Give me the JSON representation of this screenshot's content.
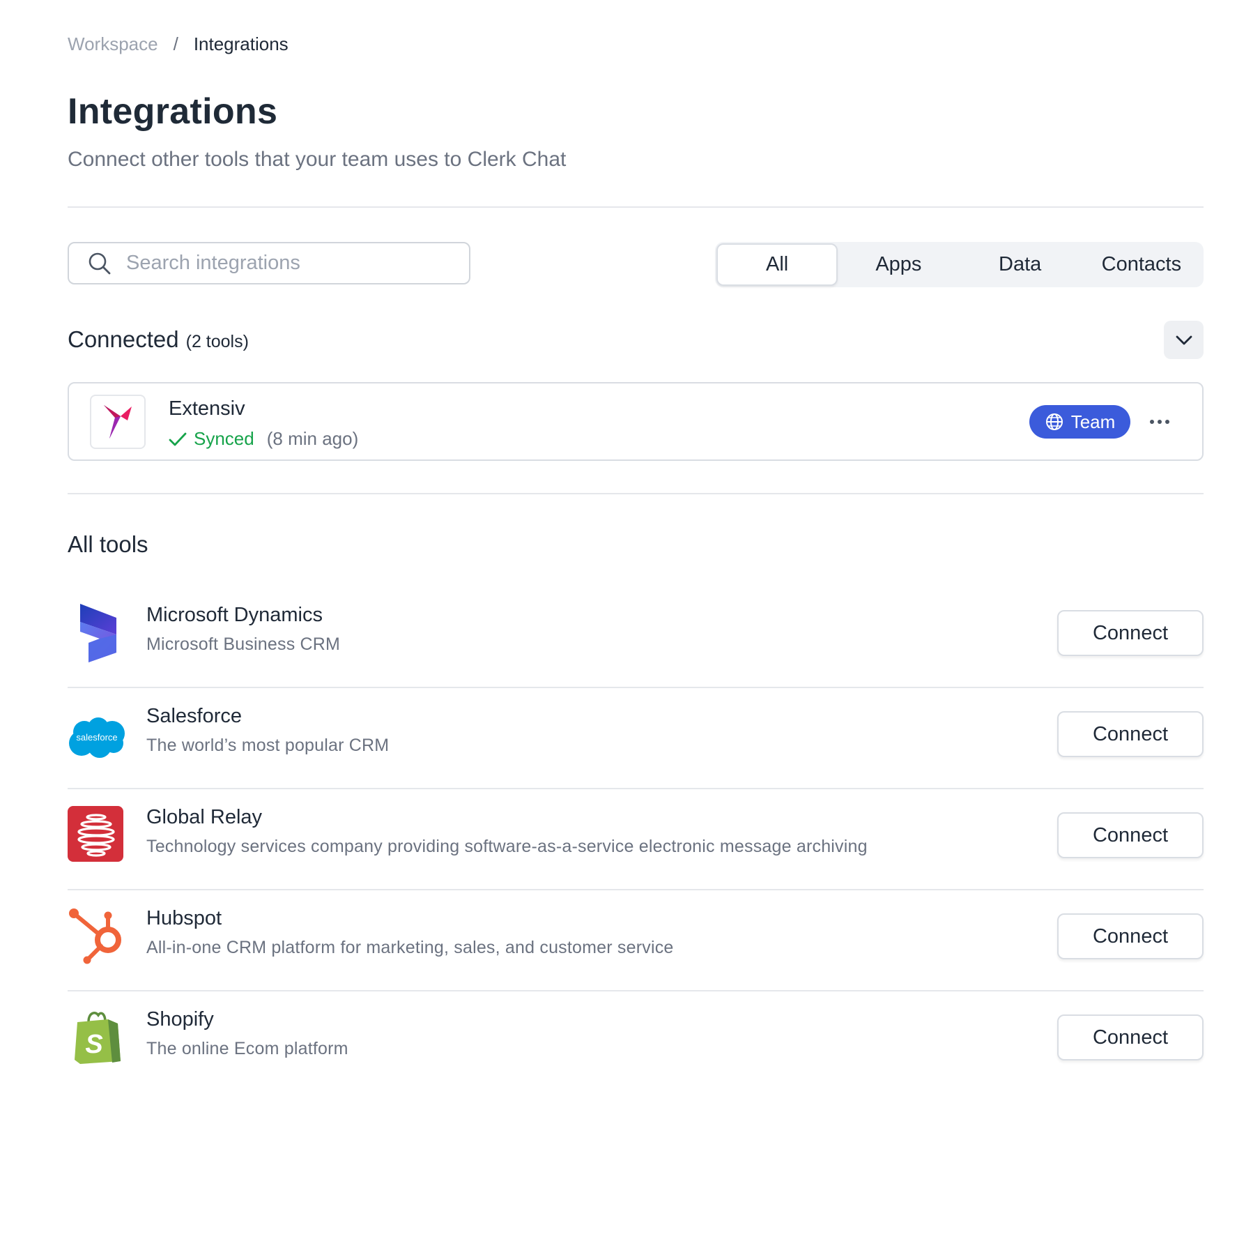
{
  "breadcrumb": {
    "root": "Workspace",
    "separator": "/",
    "current": "Integrations"
  },
  "header": {
    "title": "Integrations",
    "subtitle": "Connect other tools that your team uses to Clerk Chat"
  },
  "search": {
    "placeholder": "Search integrations",
    "value": "",
    "icon": "search-icon"
  },
  "filter_tabs": [
    {
      "label": "All",
      "active": true
    },
    {
      "label": "Apps",
      "active": false
    },
    {
      "label": "Data",
      "active": false
    },
    {
      "label": "Contacts",
      "active": false
    }
  ],
  "connected": {
    "title": "Connected",
    "count": "(2 tools)",
    "collapse_icon": "chevron-down-icon",
    "items": [
      {
        "name": "Extensiv",
        "logo": "extensiv-logo",
        "status": "Synced",
        "sync_time": "(8 min ago)",
        "scope": "Team",
        "scope_icon": "globe-icon",
        "status_color": "#16a34a",
        "badge_color": "#3b5bdb"
      }
    ]
  },
  "all_tools": {
    "title": "All tools",
    "button_label": "Connect",
    "items": [
      {
        "name": "Microsoft Dynamics",
        "description": "Microsoft Business CRM",
        "logo": "microsoft-dynamics-logo"
      },
      {
        "name": "Salesforce",
        "description": "The world’s most popular CRM",
        "logo": "salesforce-logo",
        "logo_text": "salesforce"
      },
      {
        "name": "Global Relay",
        "description": "Technology services company providing software-as-a-service electronic message archiving",
        "logo": "global-relay-logo"
      },
      {
        "name": "Hubspot",
        "description": "All-in-one CRM platform for marketing, sales, and customer service",
        "logo": "hubspot-logo"
      },
      {
        "name": "Shopify",
        "description": "The online Ecom platform",
        "logo": "shopify-logo"
      }
    ]
  }
}
